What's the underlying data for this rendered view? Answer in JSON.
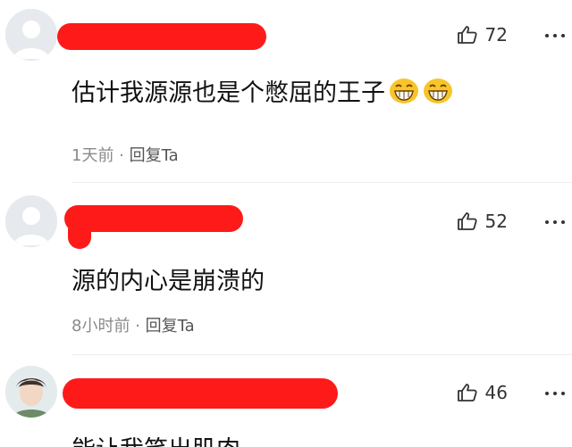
{
  "comments": [
    {
      "likes": "72",
      "text": "估计我源源也是个憋屈的王子",
      "emojis": [
        "laughing-emoji",
        "laughing-emoji"
      ],
      "time": "1天前",
      "separator": " · ",
      "reply": "回复Ta"
    },
    {
      "likes": "52",
      "text": "源的内心是崩溃的",
      "time": "8小时前",
      "separator": " · ",
      "reply": "回复Ta"
    },
    {
      "likes": "46",
      "text": "能让我笑出肌肉"
    }
  ],
  "icons": {
    "like": "thumbs-up-icon",
    "more": "more-horizontal-icon"
  },
  "colors": {
    "redaction": "#ff1a1a",
    "meta": "#8a8a8a",
    "avatar_placeholder": "#e6e9ee"
  }
}
